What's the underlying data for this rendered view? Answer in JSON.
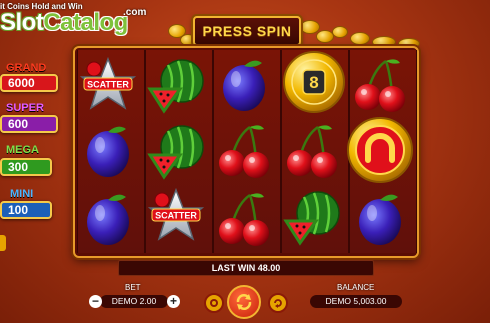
{
  "watermark": {
    "subtitle": "it Coins Hold and Win",
    "logo_a": "Slot",
    "logo_b": "Catalog",
    "com": ".com"
  },
  "banner": {
    "label": "PRESS SPIN"
  },
  "jackpots": [
    {
      "name": "GRAND",
      "value": "6000",
      "label_color": "#ff3b1f",
      "box_color": "#d8161b"
    },
    {
      "name": "SUPER",
      "value": "600",
      "label_color": "#e35cff",
      "box_color": "#8a1ea8"
    },
    {
      "name": "MEGA",
      "value": "300",
      "label_color": "#7de04a",
      "box_color": "#2f9a1f"
    },
    {
      "name": "MINI",
      "value": "100",
      "label_color": "#4ab4ff",
      "box_color": "#1c5fb8"
    }
  ],
  "reels": [
    [
      "scatter",
      "plum",
      "plum"
    ],
    [
      "watermelon",
      "watermelon",
      "scatter"
    ],
    [
      "plum",
      "cherry",
      "cherry"
    ],
    [
      "coin-8",
      "cherry",
      "watermelon"
    ],
    [
      "cherry",
      "horseshoe-coin",
      "plum"
    ]
  ],
  "symbol_text": {
    "scatter": "SCATTER",
    "coin_value": "8"
  },
  "status": {
    "last_win": "LAST WIN 48.00"
  },
  "bet": {
    "label": "BET",
    "value": "DEMO 2.00",
    "minus": "−",
    "plus": "+"
  },
  "balance": {
    "label": "BALANCE",
    "value": "DEMO 5,003.00"
  },
  "colors": {
    "frame_gold": "#e79a2a",
    "banner_text": "#ffd84a",
    "background": "#a83512"
  }
}
